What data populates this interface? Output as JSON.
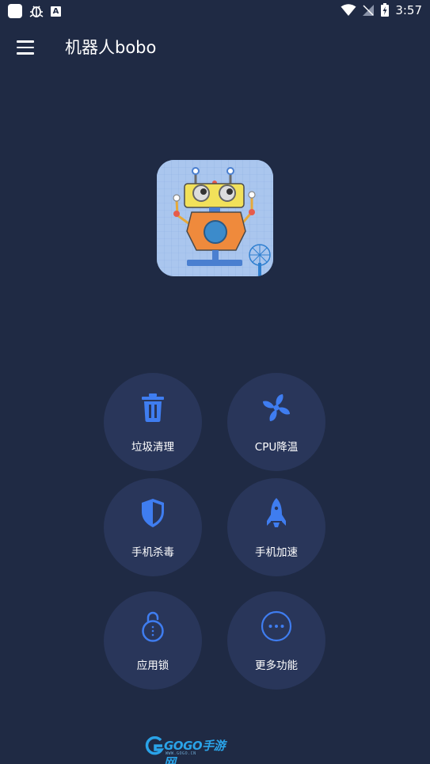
{
  "status_bar": {
    "time": "3:57",
    "notification_badge": "A"
  },
  "app_bar": {
    "title": "机器人bobo"
  },
  "features": [
    {
      "label": "垃圾清理",
      "icon": "trash-icon"
    },
    {
      "label": "CPU降温",
      "icon": "fan-icon"
    },
    {
      "label": "手机杀毒",
      "icon": "shield-icon"
    },
    {
      "label": "手机加速",
      "icon": "rocket-icon"
    },
    {
      "label": "应用锁",
      "icon": "unlock-icon"
    },
    {
      "label": "更多功能",
      "icon": "more-icon"
    }
  ],
  "footer": {
    "brand": "GOGO手游网",
    "url": "WWW.GOGO.CN"
  },
  "colors": {
    "background": "#1f2a44",
    "button_background": "#29365a",
    "icon_accent": "#3f7df0"
  }
}
